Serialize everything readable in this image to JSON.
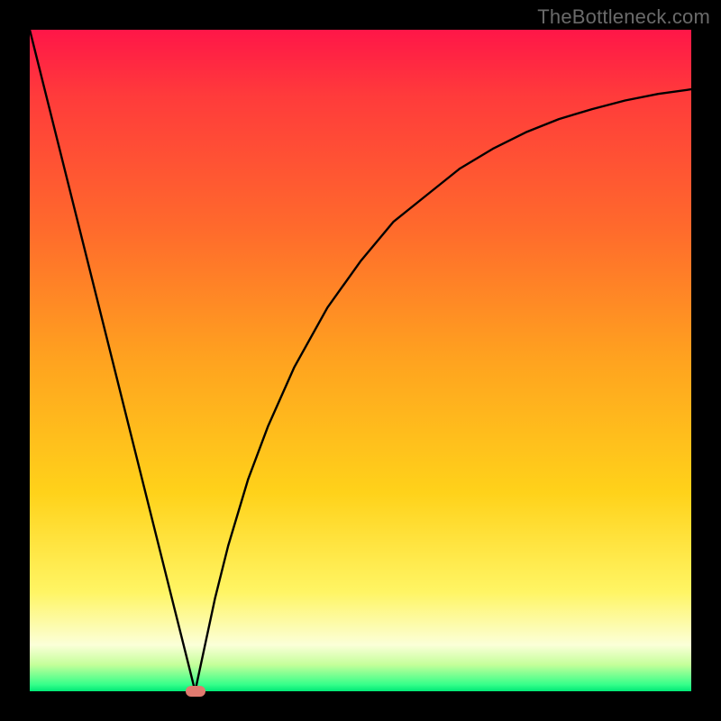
{
  "watermark": "TheBottleneck.com",
  "colors": {
    "frame": "#000000",
    "gradient_top": "#ff1648",
    "gradient_mid": "#ffd21a",
    "gradient_bottom": "#00e876",
    "curve": "#000000",
    "marker": "#e07a6f"
  },
  "chart_data": {
    "type": "line",
    "title": "",
    "xlabel": "",
    "ylabel": "",
    "xlim": [
      0,
      100
    ],
    "ylim": [
      0,
      100
    ],
    "grid": false,
    "series": [
      {
        "name": "curve",
        "x": [
          0,
          5,
          10,
          15,
          20,
          22,
          24,
          25,
          28,
          30,
          33,
          36,
          40,
          45,
          50,
          55,
          60,
          65,
          70,
          75,
          80,
          85,
          90,
          95,
          100
        ],
        "values": [
          100,
          80,
          60,
          40,
          20,
          12,
          4,
          0,
          14,
          22,
          32,
          40,
          49,
          58,
          65,
          71,
          75,
          79,
          82,
          84.5,
          86.5,
          88,
          89.3,
          90.3,
          91
        ]
      }
    ],
    "annotations": [
      {
        "name": "minimum-marker",
        "x": 25,
        "y": 0
      }
    ]
  }
}
